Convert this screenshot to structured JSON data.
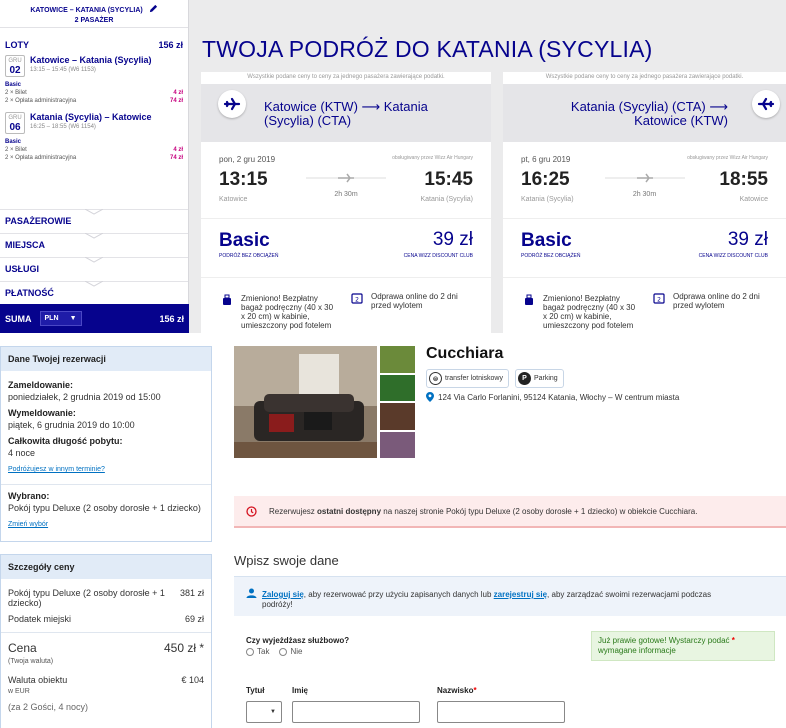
{
  "wizz": {
    "route_header": "KATOWICE – KATANIA (SYCYLIA)",
    "passengers": "2 PASAŻER",
    "lots_label": "LOTY",
    "lots_total": "156 zł",
    "legs": [
      {
        "month": "GRU",
        "day": "02",
        "route": "Katowice – Katania (Sycylia)",
        "time": "13:15 – 15:45 (W6 1153)",
        "fare": "Basic",
        "lines": [
          {
            "label": "2 × Bilet",
            "amount": "4 zł"
          },
          {
            "label": "2 × Opłata administracyjna",
            "amount": "74 zł"
          }
        ]
      },
      {
        "month": "GRU",
        "day": "06",
        "route": "Katania (Sycylia) – Katowice",
        "time": "16:25 – 18:55 (W6 1154)",
        "fare": "Basic",
        "lines": [
          {
            "label": "2 × Bilet",
            "amount": "4 zł"
          },
          {
            "label": "2 × Opłata administracyjna",
            "amount": "74 zł"
          }
        ]
      }
    ],
    "sections": [
      "PASAŻEROWIE",
      "MIEJSCA",
      "USŁUGI",
      "PŁATNOŚĆ"
    ],
    "suma_label": "SUMA",
    "currency": "PLN",
    "suma_total": "156 zł",
    "page_title": "TWOJA PODRÓŻ DO KATANIA (SYCYLIA)",
    "cards": [
      {
        "notice": "Wszystkie podane ceny to ceny za jednego pasażera zawierające podatki.",
        "route_line1": "Katowice (KTW) ⟶ Katania",
        "route_line2": "(Sycylia) (CTA)",
        "date": "pon, 2 gru 2019",
        "operator": "obsługiwany przez Wizz Air Hungary",
        "dep_time": "13:15",
        "arr_time": "15:45",
        "duration": "2h 30m",
        "dep_place": "Katowice",
        "arr_place": "Katania (Sycylia)",
        "fare": "Basic",
        "fare_sub": "PODRÓŻ BEZ OBCIĄŻEŃ",
        "price": "39 zł",
        "price_sub": "CENA WIZZ DISCOUNT CLUB",
        "feat1_l1": "Zmieniono! Bezpłatny",
        "feat1_l2": "bagaż podręczny (40 x 30",
        "feat1_l3": "x 20 cm) w kabinie,",
        "feat1_l4": "umieszczony pod fotelem",
        "feat2_l1": "Odprawa online do 2 dni",
        "feat2_l2": "przed wylotem"
      },
      {
        "notice": "Wszystkie podane ceny to ceny za jednego pasażera zawierające podatki.",
        "route_line1": "Katania (Sycylia) (CTA) ⟶",
        "route_line2": "Katowice (KTW)",
        "date": "pt, 6 gru 2019",
        "operator": "obsługiwany przez Wizz Air Hungary",
        "dep_time": "16:25",
        "arr_time": "18:55",
        "duration": "2h 30m",
        "dep_place": "Katania (Sycylia)",
        "arr_place": "Katowice",
        "fare": "Basic",
        "fare_sub": "PODRÓŻ BEZ OBCIĄŻEŃ",
        "price": "39 zł",
        "price_sub": "CENA WIZZ DISCOUNT CLUB",
        "feat1_l1": "Zmieniono! Bezpłatny",
        "feat1_l2": "bagaż podręczny (40 x 30",
        "feat1_l3": "x 20 cm) w kabinie,",
        "feat1_l4": "umieszczony pod fotelem",
        "feat2_l1": "Odprawa online do 2 dni",
        "feat2_l2": "przed wylotem"
      }
    ],
    "colors": {
      "brand": "#06038d",
      "accent": "#c6007e"
    }
  },
  "booking": {
    "details_title": "Dane Twojej rezerwacji",
    "checkin_label": "Zameldowanie:",
    "checkin_value": "poniedziałek, 2 grudnia 2019 od 15:00",
    "checkout_label": "Wymeldowanie:",
    "checkout_value": "piątek, 6 grudnia 2019 do 10:00",
    "stay_label": "Całkowita długość pobytu:",
    "stay_value": "4 noce",
    "change_dates_link": "Podróżujesz w innym terminie?",
    "selected_label": "Wybrano:",
    "selected_value": "Pokój typu Deluxe (2 osoby dorosłe + 1 dziecko)",
    "change_selection_link": "Zmień wybór",
    "price_title": "Szczegóły ceny",
    "price_room_label": "Pokój typu Deluxe (2 osoby dorosłe + 1 dziecko)",
    "price_room_value": "381 zł",
    "tax_label": "Podatek miejski",
    "tax_value": "69 zł",
    "total_label": "Cena",
    "total_sub": "(Twoja waluta)",
    "total_value": "450 zł *",
    "local_label": "Waluta obiektu",
    "local_sub": "w EUR",
    "local_value": "€ 104",
    "guests_note": "(za 2 Gości, 4 nocy)",
    "hotel_name": "Cucchiara",
    "badge1": "transfer lotniskowy",
    "badge2": "Parking",
    "address": "124 Via Carlo Forlanini, 95124 Katania, Włochy – W centrum miasta",
    "alert_pre": "Rezerwujesz ",
    "alert_bold": "ostatni dostępny",
    "alert_post": " na naszej stronie Pokój typu Deluxe (2 osoby dorosłe + 1 dziecko) w obiekcie Cucchiara.",
    "form_title": "Wpisz swoje dane",
    "login_link": "Zaloguj się",
    "login_mid": ", aby rezerwować przy użyciu zapisanych danych lub ",
    "register_link": "zarejestruj się",
    "login_post": ", aby zarządzać swoimi rezerwacjami podczas",
    "login_post2": "podróży!",
    "business_q": "Czy wyjeżdżasz służbowo?",
    "opt_yes": "Tak",
    "opt_no": "Nie",
    "ready_text": "Już prawie gotowe! Wystarczy podać",
    "ready_text2": "wymagane informacje",
    "title_label": "Tytuł",
    "first_label": "Imię",
    "last_label": "Nazwisko",
    "required_mark": "*",
    "colors": {
      "link": "#0071c2",
      "alert_bg": "#fdecec",
      "ready_bg": "#e8f5e1"
    }
  }
}
